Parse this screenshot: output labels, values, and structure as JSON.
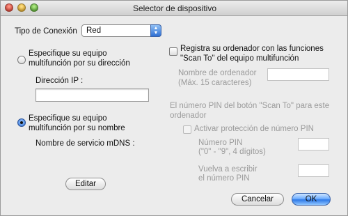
{
  "window": {
    "title": "Selector de dispositivo"
  },
  "connection": {
    "label": "Tipo de Conexión",
    "selected": "Red"
  },
  "left": {
    "radio_ip_label_line1": "Especifique su equipo",
    "radio_ip_label_line2": "multifunción por su dirección",
    "ip_label": "Dirección IP :",
    "ip_value": "",
    "radio_name_label_line1": "Especifique su equipo",
    "radio_name_label_line2": "multifunción por su nombre",
    "mdns_label": "Nombre de servicio mDNS :",
    "edit_button": "Editar"
  },
  "right": {
    "register_label_line1": "Registra su ordenador con las funciones",
    "register_label_line2": "\"Scan To\" del equipo multifunción",
    "computer_name_label_line1": "Nombre de ordenador",
    "computer_name_label_line2": "(Máx. 15 caracteres)",
    "computer_name_value": "",
    "pin_info_line1": "El número PIN del botón \"Scan To\" para este",
    "pin_info_line2": "ordenador",
    "pin_protect_label": "Activar protección de número PIN",
    "pin_label_line1": "Número PIN",
    "pin_label_line2": "(\"0\" - \"9\", 4 dígitos)",
    "pin_value": "",
    "repin_label_line1": "Vuelva a escribir",
    "repin_label_line2": "el número PIN",
    "repin_value": ""
  },
  "footer": {
    "cancel_button": "Cancelar",
    "ok_button": "OK"
  }
}
